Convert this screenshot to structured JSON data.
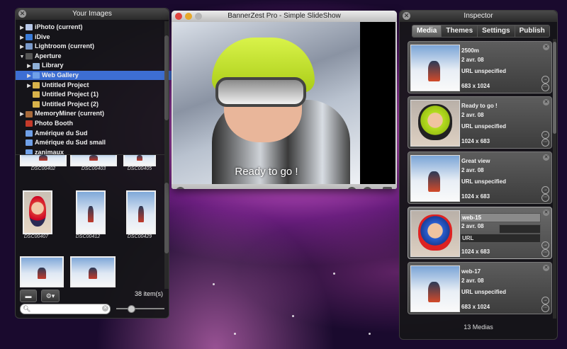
{
  "colors": {
    "selection": "#3d6ed3",
    "accent_helmet": "#c6e630"
  },
  "your_images": {
    "title": "Your Images",
    "tree": [
      {
        "label": "iPhoto (current)",
        "icon": "iphoto-icon",
        "expanded": false,
        "indent": 0
      },
      {
        "label": "iDive",
        "icon": "idive-icon",
        "expanded": false,
        "indent": 0
      },
      {
        "label": "Lightroom (current)",
        "icon": "lightroom-icon",
        "expanded": false,
        "indent": 0
      },
      {
        "label": "Aperture",
        "icon": "aperture-icon",
        "expanded": true,
        "indent": 0
      },
      {
        "label": "Library",
        "icon": "library-icon",
        "expanded": false,
        "indent": 1
      },
      {
        "label": "Web Gallery",
        "icon": "folder-icon",
        "expanded": false,
        "indent": 1,
        "selected": true
      },
      {
        "label": "Untitled Project",
        "icon": "project-icon",
        "expanded": false,
        "indent": 1
      },
      {
        "label": "Untitled Project (1)",
        "icon": "project-icon",
        "expanded": null,
        "indent": 1
      },
      {
        "label": "Untitled Project (2)",
        "icon": "project-icon",
        "expanded": null,
        "indent": 1
      },
      {
        "label": "MemoryMiner (current)",
        "icon": "memoryminer-icon",
        "expanded": false,
        "indent": 0
      },
      {
        "label": "Photo Booth",
        "icon": "photobooth-icon",
        "expanded": null,
        "indent": 0
      },
      {
        "label": "Amérique du Sud",
        "icon": "album-icon",
        "expanded": null,
        "indent": 0
      },
      {
        "label": "Amérique du Sud small",
        "icon": "album-icon",
        "expanded": null,
        "indent": 0
      },
      {
        "label": "zanimaux",
        "icon": "album-icon",
        "expanded": null,
        "indent": 0
      }
    ],
    "thumbnails": [
      {
        "name": "DSC00402",
        "style": "snow"
      },
      {
        "name": "DSC00403",
        "style": "snow"
      },
      {
        "name": "DSC00405",
        "style": "snow"
      },
      {
        "name": "DSC00407",
        "style": "face"
      },
      {
        "name": "DSC00412",
        "style": "snow"
      },
      {
        "name": "DSC00429",
        "style": "snow"
      },
      {
        "name": "",
        "style": "snow"
      },
      {
        "name": "",
        "style": "snow"
      }
    ],
    "item_count": "38 item(s)",
    "search_placeholder": "",
    "zoom_level": 0.3
  },
  "slideshow": {
    "title": "BannerZest Pro - Simple SlideShow",
    "caption": "Ready to go !"
  },
  "inspector": {
    "title": "Inspector",
    "tabs": [
      {
        "label": "Media",
        "active": true
      },
      {
        "label": "Themes",
        "active": false
      },
      {
        "label": "Settings",
        "active": false
      },
      {
        "label": "Publish",
        "active": false
      }
    ],
    "media": [
      {
        "title": "2500m",
        "date": "2 avr. 08",
        "url": "URL unspecified",
        "size": "683 x 1024",
        "thumb": "snow"
      },
      {
        "title": "Ready to go !",
        "date": "2 avr. 08",
        "url": "URL unspecified",
        "size": "1024 x 683",
        "thumb": "face"
      },
      {
        "title": "Great view",
        "date": "2 avr. 08",
        "url": "URL unspecified",
        "size": "1024 x 683",
        "thumb": "snow"
      },
      {
        "title": "web-15",
        "date": "2 avr. 08",
        "url": "URL",
        "size": "1024 x 683",
        "thumb": "blue",
        "editing": true
      },
      {
        "title": "web-17",
        "date": "2 avr. 08",
        "url": "URL unspecified",
        "size": "683 x 1024",
        "thumb": "snow"
      }
    ],
    "footer": "13 Medias"
  }
}
